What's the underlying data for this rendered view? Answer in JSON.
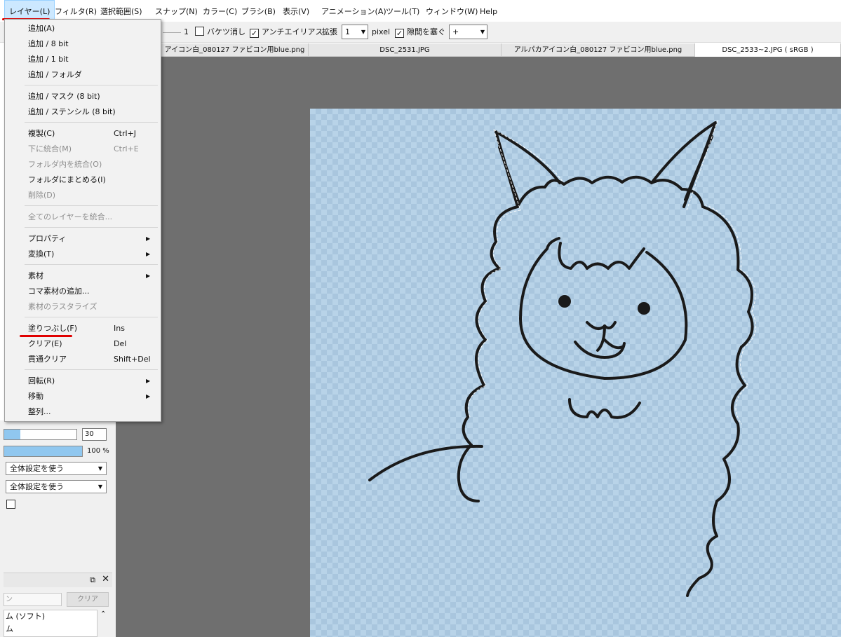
{
  "menubar": {
    "items": [
      "レイヤー(L)",
      "フィルタ(R)",
      "選択範囲(S)",
      "スナップ(N)",
      "カラー(C)",
      "ブラシ(B)",
      "表示(V)",
      "アニメーション(A)",
      "ツール(T)",
      "ウィンドウ(W)",
      "Help"
    ],
    "active_index": 0
  },
  "toolbar": {
    "partial_value": "1",
    "bucket_erase_label": "バケツ消し",
    "antialias_label": "アンチエイリアス",
    "antialias_checked": true,
    "bucket_erase_checked": false,
    "expand_label": "拡張",
    "expand_value": "1",
    "pixel_label": "pixel",
    "close_gap_label": "隙間を塞ぐ",
    "close_gap_checked": true,
    "gap_value": "+"
  },
  "tabs": [
    "アイコン白_080127 ファビコン用blue.png",
    "DSC_2531.JPG",
    "アルパカアイコン白_080127 ファビコン用blue.png",
    "DSC_2533~2.JPG ( sRGB )"
  ],
  "layer_menu": {
    "items": [
      {
        "label": "追加(A)",
        "shortcut": "",
        "disabled": false,
        "submenu": false
      },
      {
        "label": "追加 / 8 bit",
        "shortcut": "",
        "disabled": false,
        "submenu": false
      },
      {
        "label": "追加 / 1 bit",
        "shortcut": "",
        "disabled": false,
        "submenu": false
      },
      {
        "label": "追加 / フォルダ",
        "shortcut": "",
        "disabled": false,
        "submenu": false
      },
      {
        "label": "追加 / マスク (8 bit)",
        "shortcut": "",
        "disabled": false,
        "submenu": false
      },
      {
        "label": "追加 / ステンシル (8 bit)",
        "shortcut": "",
        "disabled": false,
        "submenu": false
      },
      {
        "label": "複製(C)",
        "shortcut": "Ctrl+J",
        "disabled": false,
        "submenu": false
      },
      {
        "label": "下に統合(M)",
        "shortcut": "Ctrl+E",
        "disabled": true,
        "submenu": false
      },
      {
        "label": "フォルダ内を統合(O)",
        "shortcut": "",
        "disabled": true,
        "submenu": false
      },
      {
        "label": "フォルダにまとめる(I)",
        "shortcut": "",
        "disabled": false,
        "submenu": false
      },
      {
        "label": "削除(D)",
        "shortcut": "",
        "disabled": true,
        "submenu": false
      },
      {
        "label": "全てのレイヤーを統合...",
        "shortcut": "",
        "disabled": true,
        "submenu": false
      },
      {
        "label": "プロパティ",
        "shortcut": "",
        "disabled": false,
        "submenu": true
      },
      {
        "label": "変換(T)",
        "shortcut": "",
        "disabled": false,
        "submenu": true
      },
      {
        "label": "素材",
        "shortcut": "",
        "disabled": false,
        "submenu": true
      },
      {
        "label": "コマ素材の追加...",
        "shortcut": "",
        "disabled": false,
        "submenu": false
      },
      {
        "label": "素材のラスタライズ",
        "shortcut": "",
        "disabled": true,
        "submenu": false
      },
      {
        "label": "塗りつぶし(F)",
        "shortcut": "Ins",
        "disabled": false,
        "submenu": false
      },
      {
        "label": "クリア(E)",
        "shortcut": "Del",
        "disabled": false,
        "submenu": false
      },
      {
        "label": "貫通クリア",
        "shortcut": "Shift+Del",
        "disabled": false,
        "submenu": false
      },
      {
        "label": "回転(R)",
        "shortcut": "",
        "disabled": false,
        "submenu": true
      },
      {
        "label": "移動",
        "shortcut": "",
        "disabled": false,
        "submenu": true
      },
      {
        "label": "整列...",
        "shortcut": "",
        "disabled": false,
        "submenu": false
      }
    ],
    "highlighted_label": "塗りつぶし(F)"
  },
  "left_panel": {
    "size_value": "30",
    "size_fraction": 0.22,
    "opacity_value": "100 %",
    "opacity_fraction": 1.0,
    "combo1": "全体設定を使う",
    "combo2": "全体設定を使う",
    "checkbox_checked": false,
    "search_placeholder": "ン",
    "clear_button": "クリア",
    "list_rows": [
      "ム (ソフト)",
      "ム"
    ]
  },
  "colors": {
    "accent_red": "#e00000",
    "menu_active": "#cce8ff",
    "canvas_bg": "#6f6f6f",
    "doc_bg": "#b8d3e8",
    "slider_fill": "#90c7ef"
  }
}
